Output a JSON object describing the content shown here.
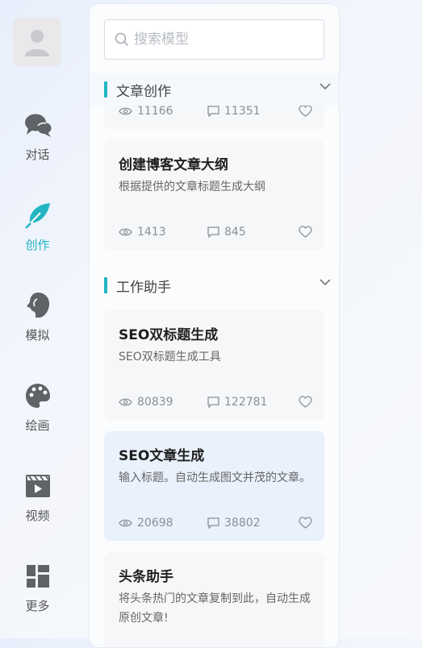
{
  "nav": {
    "items": [
      {
        "label": "对话",
        "icon": "chat-bubbles-icon"
      },
      {
        "label": "创作",
        "icon": "feather-icon"
      },
      {
        "label": "模拟",
        "icon": "face-profile-icon"
      },
      {
        "label": "绘画",
        "icon": "palette-icon"
      },
      {
        "label": "视频",
        "icon": "video-clapper-icon"
      },
      {
        "label": "更多",
        "icon": "grid-dashboard-icon"
      }
    ],
    "active": "创作"
  },
  "search": {
    "placeholder": "搜索模型",
    "value": ""
  },
  "sections": [
    {
      "title": "文章创作",
      "partial_card_stats": {
        "views": "11166",
        "comments": "11351"
      },
      "cards": [
        {
          "title": "创建博客文章大纲",
          "desc": "根据提供的文章标题生成大纲",
          "views": "1413",
          "comments": "845"
        }
      ]
    },
    {
      "title": "工作助手",
      "cards": [
        {
          "title": "SEO双标题生成",
          "desc": "SEO双标题生成工具",
          "views": "80839",
          "comments": "122781"
        },
        {
          "title": "SEO文章生成",
          "desc": "输入标题。自动生成图文并茂的文章。",
          "views": "20698",
          "comments": "38802"
        },
        {
          "title": "头条助手",
          "desc": "将头条热门的文章复制到此，自动生成原创文章!"
        }
      ]
    }
  ],
  "colors": {
    "accent": "#23b5c2",
    "icon_gray": "#5f6368",
    "highlight_card": "#e9f1fc"
  }
}
